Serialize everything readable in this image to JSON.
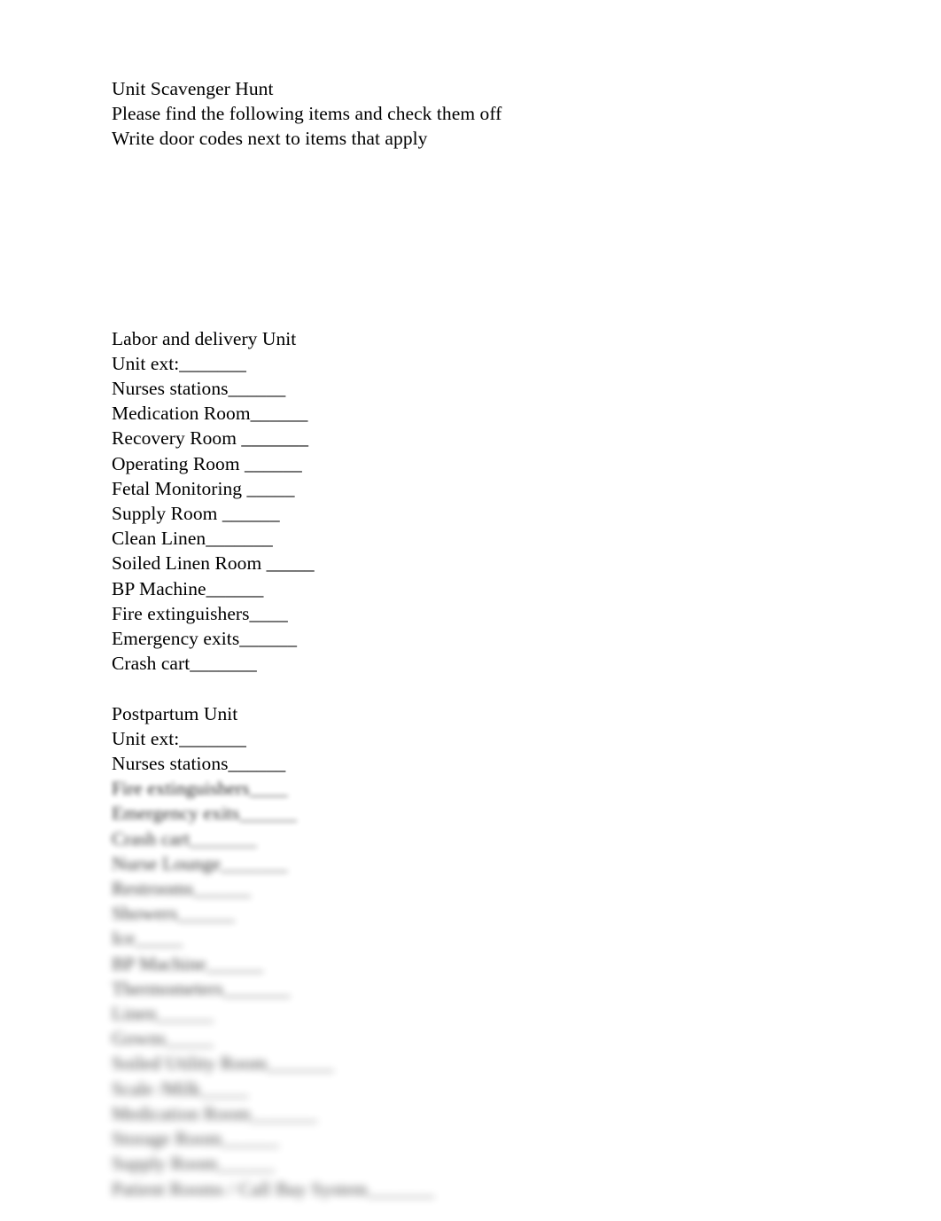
{
  "document": {
    "header": {
      "title": "Unit Scavenger Hunt",
      "instruction_1": "Please find the following items and check them off",
      "instruction_2": "Write door codes next to items that apply"
    },
    "sections": [
      {
        "heading": "Labor and delivery Unit",
        "blurred": false,
        "items": [
          "Unit ext:_______",
          "Nurses stations______",
          "Medication Room______",
          "Recovery Room _______",
          "Operating Room ______",
          "Fetal Monitoring _____",
          "Supply Room ______",
          "Clean Linen_______",
          "Soiled Linen Room _____",
          "BP Machine______",
          "Fire extinguishers____",
          "Emergency exits______",
          "Crash cart_______"
        ]
      },
      {
        "heading": "Postpartum Unit",
        "blurred": false,
        "items": [
          "Unit ext:_______",
          "Nurses stations______"
        ]
      }
    ],
    "blurred_continuation": {
      "note": "Remaining Postpartum Unit checklist lines are obscured by a preview blur",
      "items": [
        "Fire extinguishers____",
        "Emergency exits______",
        "Crash cart_______",
        "Nurse Lounge_______",
        "Restrooms______",
        "Showers______",
        "Ice_____",
        "BP Machine______",
        "Thermometers_______",
        "Linen______",
        "Gowns_____",
        "Soiled Utility Room_______",
        "Scale /Milk_____",
        "Medication Room_______",
        "Storage Room______",
        "Supply Room______",
        "Patient Rooms / Call Bay System_______"
      ]
    }
  }
}
